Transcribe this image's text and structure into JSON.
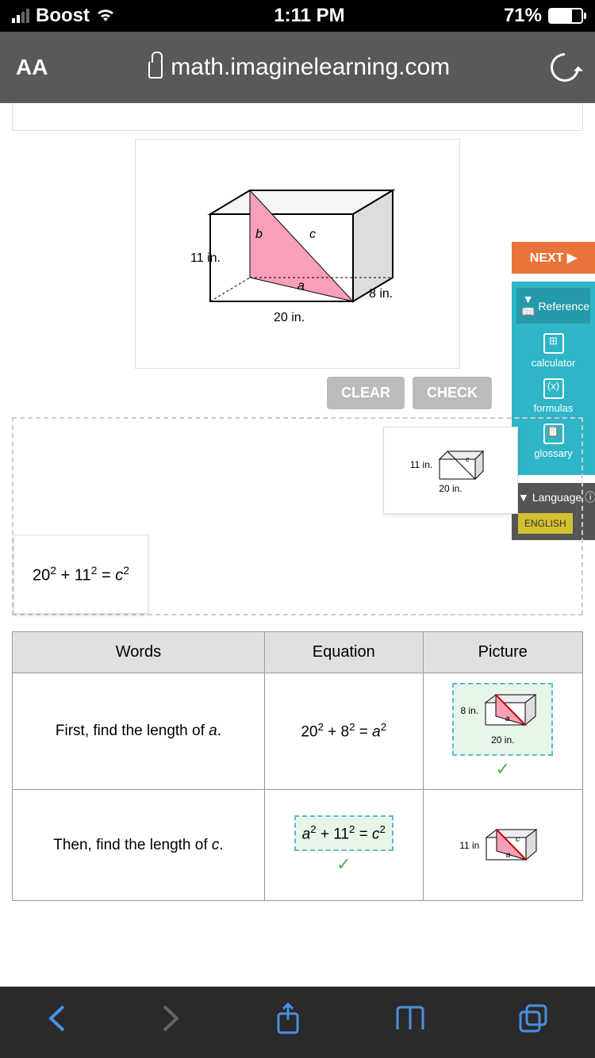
{
  "status": {
    "carrier": "Boost",
    "time": "1:11 PM",
    "battery": "71%"
  },
  "nav": {
    "aa": "AA",
    "url": "math.imaginelearning.com"
  },
  "side": {
    "next": "NEXT ▶",
    "reference": "Reference",
    "calculator": "calculator",
    "formulas": "formulas",
    "glossary": "glossary",
    "language": "Language",
    "english": "ENGLISH"
  },
  "buttons": {
    "clear": "CLEAR",
    "check": "CHECK"
  },
  "diagram": {
    "height": "11 in.",
    "width": "20 in.",
    "depth": "8 in.",
    "a": "a",
    "b": "b",
    "c": "c"
  },
  "tiles": {
    "tile1": {
      "height": "11 in.",
      "width": "20 in.",
      "c": "c"
    },
    "tile2": "20² + 11² = c²"
  },
  "table": {
    "headers": {
      "words": "Words",
      "equation": "Equation",
      "picture": "Picture"
    },
    "row1": {
      "words": "First, find the length of a.",
      "equation": "20² + 8² = a²",
      "pic": {
        "depth": "8 in.",
        "width": "20 in.",
        "a": "a"
      }
    },
    "row2": {
      "words": "Then, find the length of c.",
      "equation": "a² + 11² = c²",
      "pic": {
        "height": "11 in",
        "a": "a",
        "c": "c"
      }
    }
  }
}
